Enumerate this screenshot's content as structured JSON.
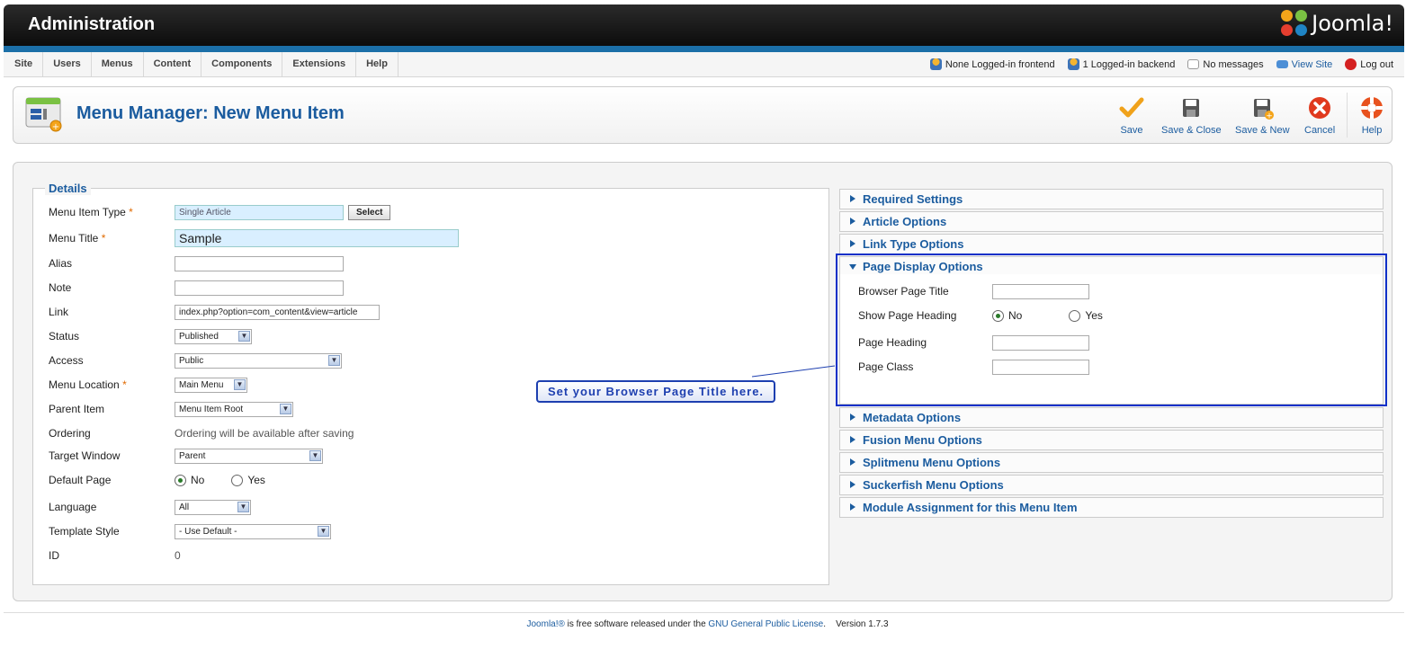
{
  "header": {
    "title": "Administration",
    "logo_text": "Joomla!"
  },
  "menu": [
    "Site",
    "Users",
    "Menus",
    "Content",
    "Components",
    "Extensions",
    "Help"
  ],
  "status": {
    "frontend": "None Logged-in frontend",
    "backend": "1 Logged-in backend",
    "messages": "No messages",
    "view_site": "View Site",
    "logout": "Log out"
  },
  "page_title": "Menu Manager: New Menu Item",
  "toolbar": {
    "save": "Save",
    "save_close": "Save & Close",
    "save_new": "Save & New",
    "cancel": "Cancel",
    "help": "Help"
  },
  "details": {
    "legend": "Details",
    "required_mark": "*",
    "menu_item_type": {
      "label": "Menu Item Type",
      "value": "Single Article",
      "button": "Select"
    },
    "menu_title": {
      "label": "Menu Title",
      "value": "Sample"
    },
    "alias": {
      "label": "Alias",
      "value": ""
    },
    "note": {
      "label": "Note",
      "value": ""
    },
    "link": {
      "label": "Link",
      "value": "index.php?option=com_content&view=article"
    },
    "status": {
      "label": "Status",
      "value": "Published"
    },
    "access": {
      "label": "Access",
      "value": "Public"
    },
    "menu_location": {
      "label": "Menu Location",
      "value": "Main Menu"
    },
    "parent_item": {
      "label": "Parent Item",
      "value": "Menu Item Root"
    },
    "ordering": {
      "label": "Ordering",
      "value": "Ordering will be available after saving"
    },
    "target_window": {
      "label": "Target Window",
      "value": "Parent"
    },
    "default_page": {
      "label": "Default Page",
      "no": "No",
      "yes": "Yes",
      "selected": "No"
    },
    "language": {
      "label": "Language",
      "value": "All"
    },
    "template_style": {
      "label": "Template Style",
      "value": "- Use Default -"
    },
    "id": {
      "label": "ID",
      "value": "0"
    }
  },
  "panels": {
    "required_settings": "Required Settings",
    "article_options": "Article Options",
    "link_type_options": "Link Type Options",
    "page_display_options": "Page Display Options",
    "metadata_options": "Metadata Options",
    "fusion_menu_options": "Fusion Menu Options",
    "splitmenu_menu_options": "Splitmenu Menu Options",
    "suckerfish_menu_options": "Suckerfish Menu Options",
    "module_assignment": "Module Assignment for this Menu Item"
  },
  "page_display": {
    "browser_page_title": {
      "label": "Browser Page Title",
      "value": ""
    },
    "show_page_heading": {
      "label": "Show Page Heading",
      "no": "No",
      "yes": "Yes",
      "selected": "No"
    },
    "page_heading": {
      "label": "Page Heading",
      "value": ""
    },
    "page_class": {
      "label": "Page Class",
      "value": ""
    }
  },
  "callout": "Set your Browser Page Title here.",
  "footer": {
    "joomla_link": "Joomla!®",
    "text": " is free software released under the ",
    "license_link": "GNU General Public License",
    "version": ".    Version 1.7.3"
  },
  "colors": {
    "accent": "#1b5c9f",
    "header_bg": "#111111",
    "stripe": "#1b6fa8",
    "callout_border": "#1d3fb0"
  },
  "icons": {
    "save": "checkmark-icon",
    "save_close": "floppy-disk-icon",
    "save_new": "floppy-disk-plus-icon",
    "cancel": "cancel-x-icon",
    "help": "lifebuoy-icon"
  }
}
